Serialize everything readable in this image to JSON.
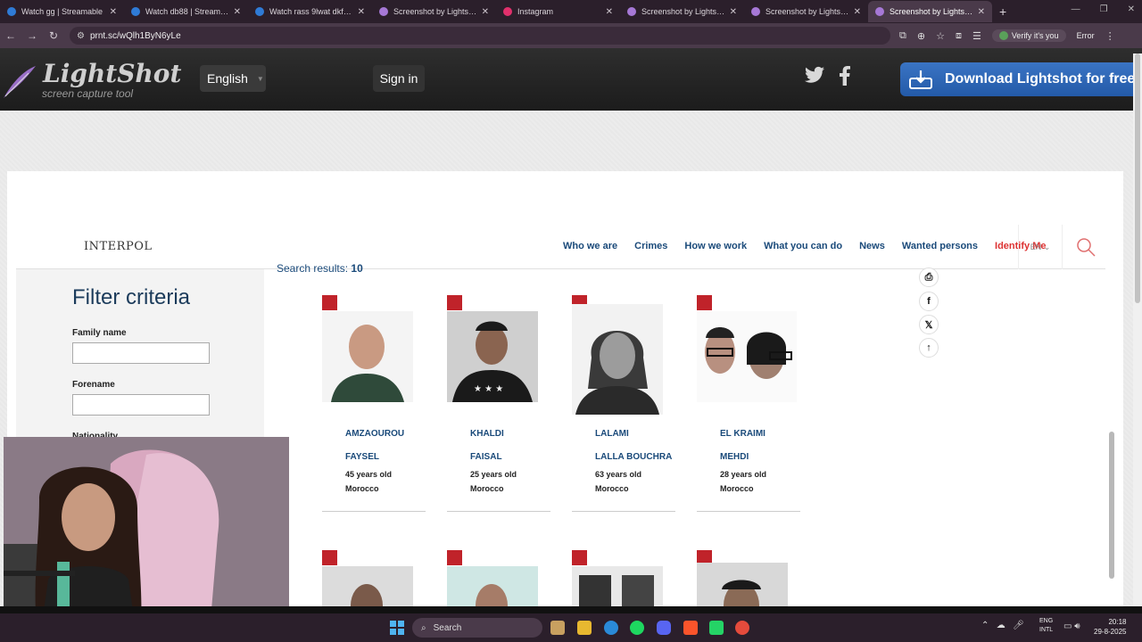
{
  "browser": {
    "tabs": [
      {
        "label": "Watch gg | Streamable",
        "color": "#2f7bd6",
        "active": false
      },
      {
        "label": "Watch db88 | Streamable",
        "color": "#2f7bd6",
        "active": false
      },
      {
        "label": "Watch rass 9lwat dkfat | S",
        "color": "#2f7bd6",
        "active": false
      },
      {
        "label": "Screenshot by Lightshot",
        "color": "#a678d6",
        "active": false
      },
      {
        "label": "Instagram",
        "color": "#e1306c",
        "active": false
      },
      {
        "label": "Screenshot by Lightshot",
        "color": "#a678d6",
        "active": false
      },
      {
        "label": "Screenshot by Lightshot",
        "color": "#a678d6",
        "active": false
      },
      {
        "label": "Screenshot by Lightshot",
        "color": "#a678d6",
        "active": true
      }
    ],
    "new_tab": "+",
    "url": "prnt.sc/wQlh1ByN6yLe",
    "verify_label": "Verify it's you",
    "error_label": "Error"
  },
  "lightshot": {
    "logo_title": "LightShot",
    "logo_subtitle": "screen capture tool",
    "language": "English",
    "sign_in": "Sign in",
    "download": "Download Lightshot for free"
  },
  "interpol": {
    "logo": "INTERPOL",
    "menu": [
      "Who we are",
      "Crimes",
      "How we work",
      "What you can do",
      "News",
      "Wanted persons",
      "Identify Me"
    ],
    "lang": "EN",
    "search_results_label": "Search results:",
    "search_results_count": "10",
    "filter_title": "Filter criteria",
    "family_name_label": "Family name",
    "forename_label": "Forename",
    "nationality_label": "Nationality",
    "persons": [
      {
        "family": "AMZAOUROU",
        "forename": "FAYSEL",
        "age": "45 years old",
        "nationality": "Morocco"
      },
      {
        "family": "KHALDI",
        "forename": "FAISAL",
        "age": "25 years old",
        "nationality": "Morocco"
      },
      {
        "family": "LALAMI",
        "forename": "LALLA BOUCHRA",
        "age": "63 years old",
        "nationality": "Morocco"
      },
      {
        "family": "EL KRAIMI",
        "forename": "MEHDI",
        "age": "28 years old",
        "nationality": "Morocco"
      }
    ]
  },
  "taskbar": {
    "search": "Search",
    "lang_top": "ENG",
    "lang_bottom": "INTL",
    "time": "20:18",
    "date": "29-8-2025"
  },
  "colors": {
    "interpol_blue": "#1a4a7a",
    "interpol_red": "#c0232a",
    "lightshot_blue": "#2f6bbf"
  }
}
